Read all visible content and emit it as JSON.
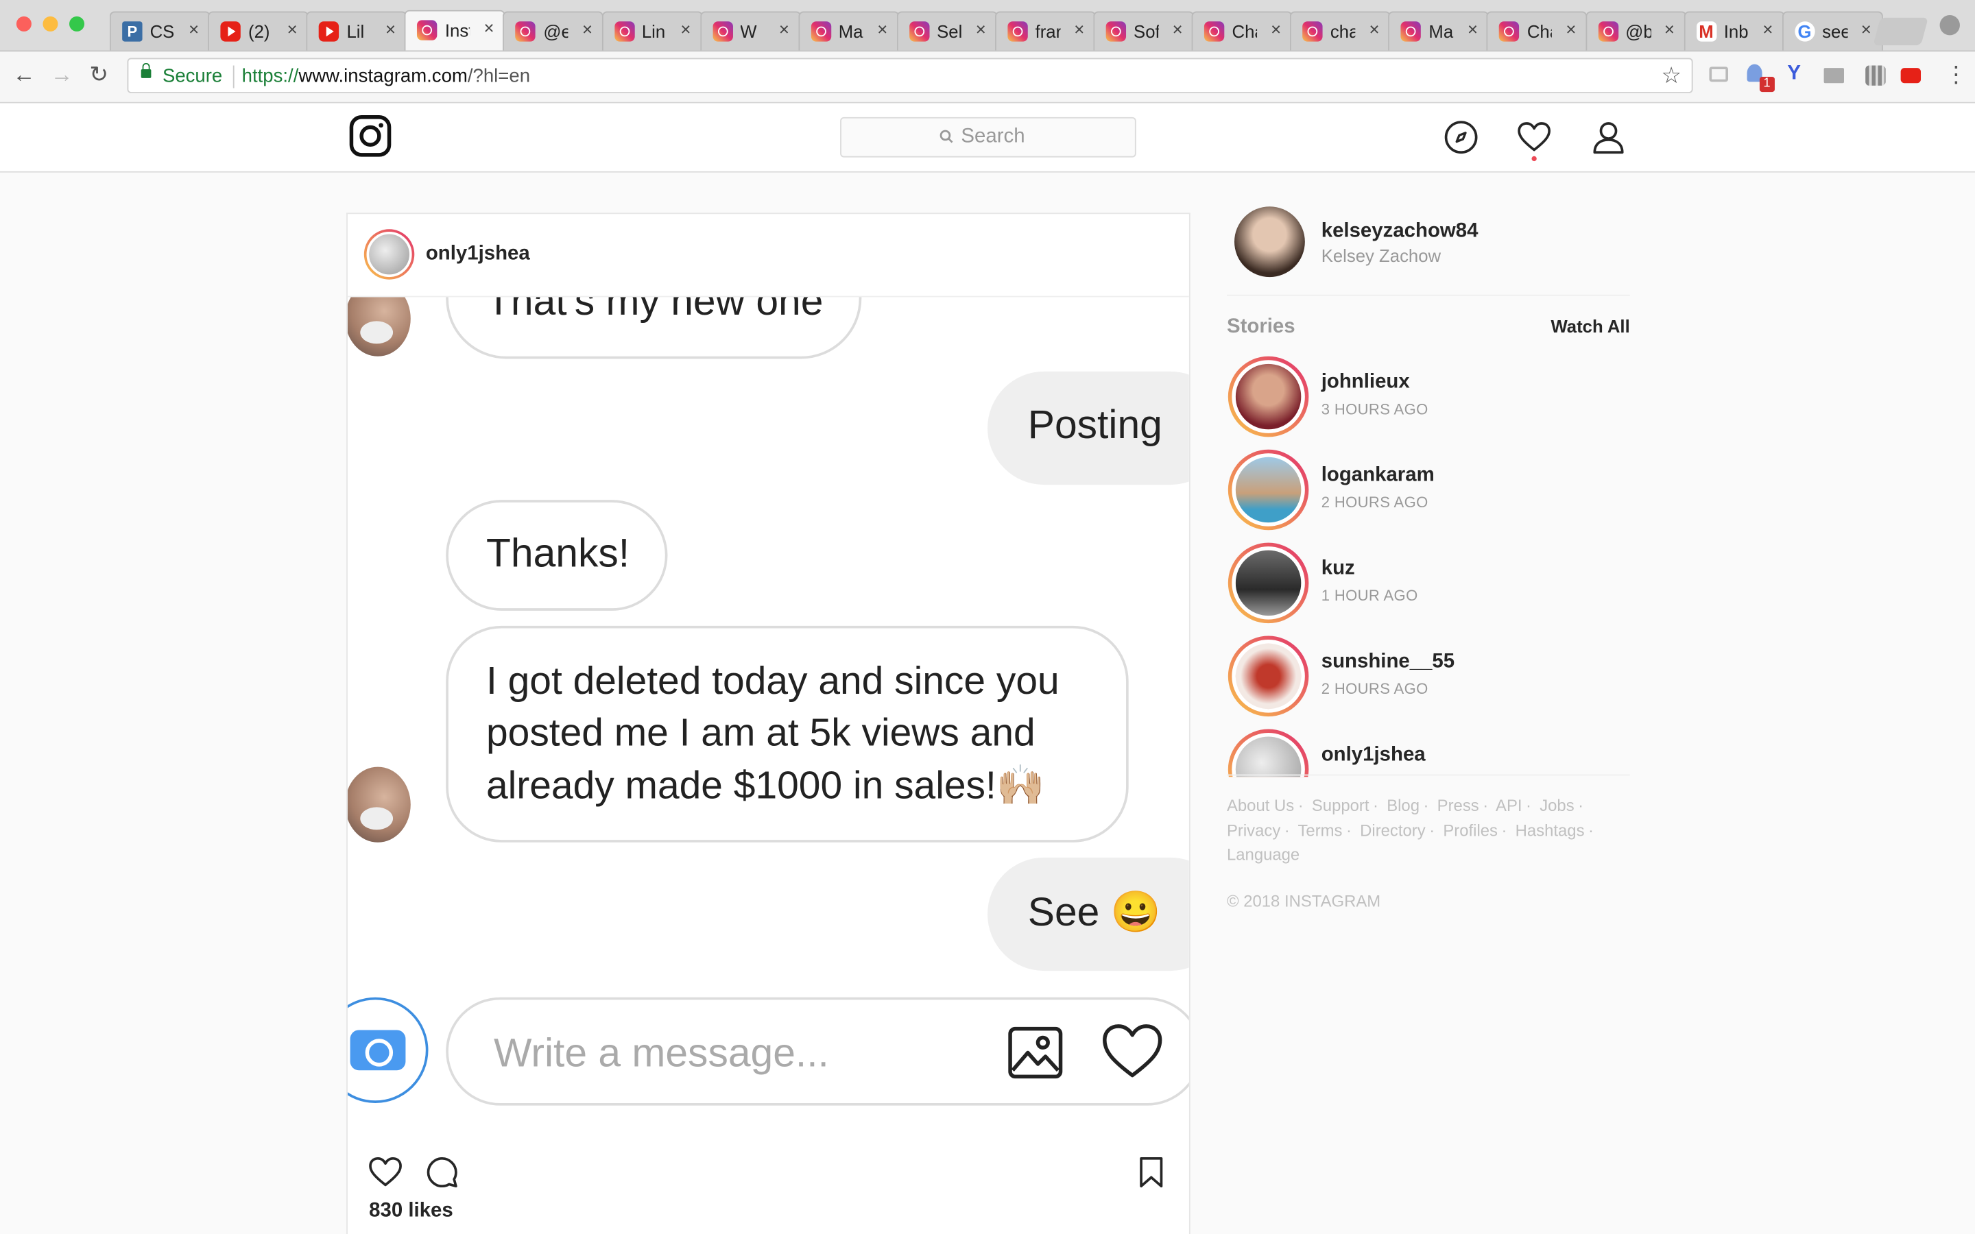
{
  "browser": {
    "tabs": [
      {
        "title": "CS",
        "icon": "p-icon"
      },
      {
        "title": "(2)",
        "icon": "youtube-icon"
      },
      {
        "title": "Lil",
        "icon": "youtube-icon"
      },
      {
        "title": "Inst",
        "icon": "instagram-icon",
        "active": true
      },
      {
        "title": "@e",
        "icon": "instagram-icon"
      },
      {
        "title": "Lin",
        "icon": "instagram-icon"
      },
      {
        "title": "W",
        "icon": "instagram-icon"
      },
      {
        "title": "Ma",
        "icon": "instagram-icon"
      },
      {
        "title": "Sel",
        "icon": "instagram-icon"
      },
      {
        "title": "frar",
        "icon": "instagram-icon"
      },
      {
        "title": "Sof",
        "icon": "instagram-icon"
      },
      {
        "title": "Cha",
        "icon": "instagram-icon"
      },
      {
        "title": "cha",
        "icon": "instagram-icon"
      },
      {
        "title": "Ma",
        "icon": "instagram-icon"
      },
      {
        "title": "Cha",
        "icon": "instagram-icon"
      },
      {
        "title": "@b",
        "icon": "instagram-icon"
      },
      {
        "title": "Inb",
        "icon": "gmail-icon"
      },
      {
        "title": "see",
        "icon": "google-icon"
      }
    ],
    "close_glyph": "×",
    "address": {
      "secure_label": "Secure",
      "scheme": "https://",
      "host": "www.instagram.com",
      "path": "/?hl=en"
    },
    "extension_badge": "1"
  },
  "nav": {
    "search_placeholder": "Search"
  },
  "post": {
    "username": "only1jshea",
    "media": {
      "messages": [
        {
          "text": "That's my new one",
          "direction": "outgoing"
        },
        {
          "text": "Posting",
          "direction": "incoming"
        },
        {
          "text": "Thanks!",
          "direction": "outgoing"
        },
        {
          "lines": [
            "I got deleted today and since you",
            "posted me I am at 5k views and",
            "already made $1000 in sales!🙌🏼"
          ],
          "direction": "outgoing"
        },
        {
          "text": "See 😀",
          "direction": "incoming"
        }
      ],
      "input_placeholder": "Write a message..."
    },
    "likes": "830 likes"
  },
  "sidebar": {
    "me": {
      "username": "kelseyzachow84",
      "full_name": "Kelsey Zachow"
    },
    "stories_header": "Stories",
    "watch_all": "Watch All",
    "stories": [
      {
        "username": "johnlieux",
        "time": "3 HOURS AGO"
      },
      {
        "username": "logankaram",
        "time": "2 HOURS AGO"
      },
      {
        "username": "kuz",
        "time": "1 HOUR AGO"
      },
      {
        "username": "sunshine__55",
        "time": "2 HOURS AGO"
      },
      {
        "username": "only1jshea",
        "time": ""
      }
    ],
    "footer_links": [
      "About Us",
      "Support",
      "Blog",
      "Press",
      "API",
      "Jobs",
      "Privacy",
      "Terms",
      "Directory",
      "Profiles",
      "Hashtags",
      "Language"
    ],
    "footer_separator": "·",
    "copyright": "© 2018 INSTAGRAM"
  }
}
